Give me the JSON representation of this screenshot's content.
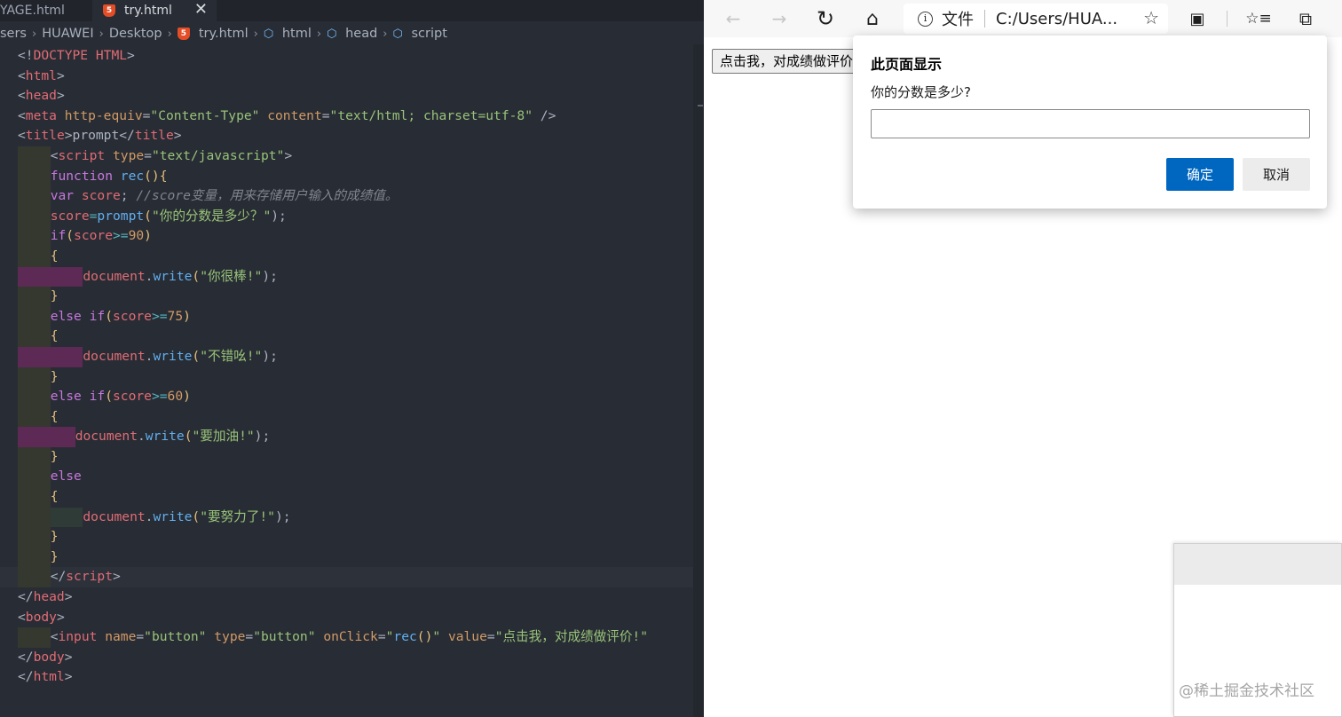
{
  "editor": {
    "tabs": [
      {
        "label": "YAGE.html"
      },
      {
        "label": "try.html",
        "close": "✕",
        "icon_letter": "5"
      }
    ],
    "breadcrumb": [
      "sers",
      "HUAWEI",
      "Desktop",
      "try.html",
      "html",
      "head",
      "script"
    ],
    "code": {
      "l1": [
        "<!",
        "DOCTYPE HTML",
        ">"
      ],
      "l2": [
        "<",
        "html",
        ">"
      ],
      "l3": [
        "<",
        "head",
        ">"
      ],
      "l4": [
        "<",
        "meta",
        " ",
        "http-equiv",
        "=",
        "\"Content-Type\"",
        " ",
        "content",
        "=",
        "\"text/html; charset=utf-8\"",
        " />"
      ],
      "l5": [
        "<",
        "title",
        ">",
        "prompt",
        "</",
        "title",
        ">"
      ],
      "l6": [
        "<",
        "script",
        " ",
        "type",
        "=",
        "\"text/javascript\"",
        ">"
      ],
      "l7": [
        "function",
        " ",
        "rec",
        "(){"
      ],
      "l8": [
        "var",
        " ",
        "score",
        "; ",
        "//score变量，用来存储用户输入的成绩值。"
      ],
      "l9": [
        "score",
        "=",
        "prompt",
        "(",
        "\"你的分数是多少？\"",
        ");"
      ],
      "l10": [
        "if",
        "(",
        "score",
        ">=",
        "90",
        ")"
      ],
      "l11": [
        "{"
      ],
      "l12": [
        "document",
        ".",
        "write",
        "(",
        "\"你很棒!\"",
        ");"
      ],
      "l13": [
        "}"
      ],
      "l14": [
        "else",
        " ",
        "if",
        "(",
        "score",
        ">=",
        "75",
        ")"
      ],
      "l15": [
        "{"
      ],
      "l16": [
        "document",
        ".",
        "write",
        "(",
        "\"不错吆!\"",
        ");"
      ],
      "l17": [
        "}"
      ],
      "l18": [
        "else",
        " ",
        "if",
        "(",
        "score",
        ">=",
        "60",
        ")"
      ],
      "l19": [
        "{"
      ],
      "l20": [
        "document",
        ".",
        "write",
        "(",
        "\"要加油!\"",
        ");"
      ],
      "l21": [
        "}"
      ],
      "l22": [
        "else"
      ],
      "l23": [
        "{"
      ],
      "l24": [
        "document",
        ".",
        "write",
        "(",
        "\"要努力了!\"",
        ");"
      ],
      "l25": [
        "}"
      ],
      "l26": [
        "}"
      ],
      "l27": [
        "</",
        "script",
        ">"
      ],
      "l28": [
        "</",
        "head",
        ">"
      ],
      "l29": [
        "<",
        "body",
        ">"
      ],
      "l30": [
        "<",
        "input",
        " ",
        "name",
        "=",
        "\"button\"",
        " ",
        "type",
        "=",
        "\"button\"",
        " ",
        "onClick",
        "=",
        "\"",
        "rec",
        "()",
        "\"",
        " ",
        "value",
        "=",
        "\"点击我，对成绩做评价!\""
      ],
      "l31": [
        "</",
        "body",
        ">"
      ],
      "l32": [
        "</",
        "html",
        ">"
      ]
    }
  },
  "browser": {
    "address": {
      "scheme_label": "文件",
      "url": "C:/Users/HUA...",
      "info_icon": "i"
    },
    "icons": {
      "back": "←",
      "forward": "→",
      "refresh": "↻",
      "home": "⌂",
      "star": "☆",
      "collections": "✧",
      "favorites": "☆≡",
      "extensions": "⧉",
      "tab_icon": "▣"
    },
    "page_button_value": "点击我，对成绩做评价!",
    "dialog": {
      "title": "此页面显示",
      "message": "你的分数是多少?",
      "input_value": "",
      "ok_label": "确定",
      "cancel_label": "取消"
    }
  },
  "watermark": "@稀土掘金技术社区",
  "colors": {
    "editor_bg": "#282c34",
    "accent_blue": "#0067c0",
    "tag_red": "#e06c75",
    "string_green": "#98c379",
    "keyword_purple": "#c678dd",
    "function_blue": "#61afef",
    "attr_orange": "#d19a66"
  }
}
